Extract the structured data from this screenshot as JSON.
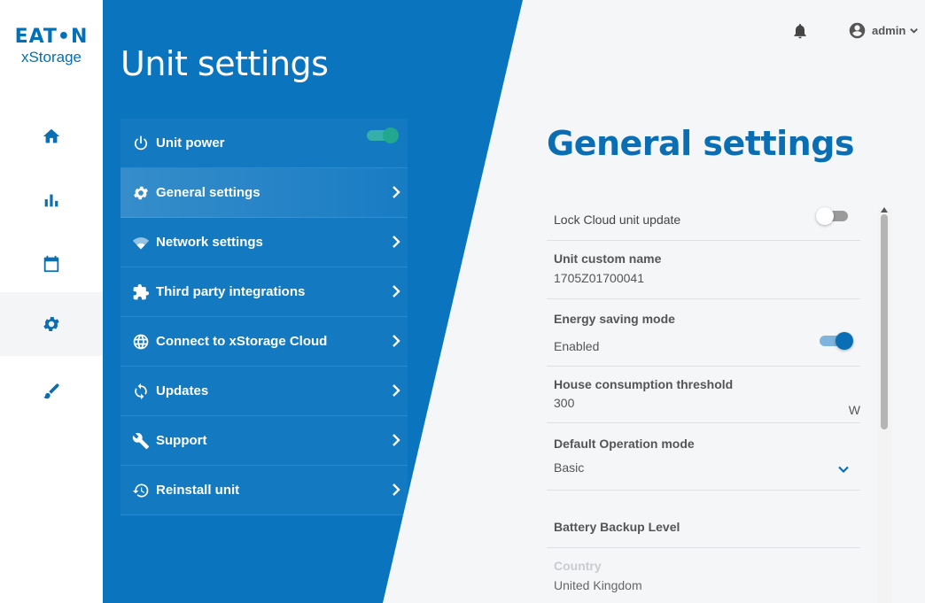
{
  "brand": {
    "logo_text": "EAT•N",
    "product": "xStorage"
  },
  "rail": {
    "items": [
      {
        "id": "home",
        "icon": "home-icon"
      },
      {
        "id": "stats",
        "icon": "bar-chart-icon"
      },
      {
        "id": "calendar",
        "icon": "calendar-icon"
      },
      {
        "id": "settings",
        "icon": "gear-icon",
        "active": true
      },
      {
        "id": "tools",
        "icon": "wrench-pencil-icon"
      }
    ]
  },
  "panel": {
    "title": "Unit settings",
    "items": [
      {
        "label": "Unit power",
        "icon": "power-icon",
        "toggle": true,
        "toggle_on": true
      },
      {
        "label": "General settings",
        "icon": "gear-icon",
        "active": true
      },
      {
        "label": "Network settings",
        "icon": "wifi-icon"
      },
      {
        "label": "Third party integrations",
        "icon": "puzzle-icon"
      },
      {
        "label": "Connect to xStorage Cloud",
        "icon": "globe-icon"
      },
      {
        "label": "Updates",
        "icon": "sync-icon"
      },
      {
        "label": "Support",
        "icon": "wrench-icon"
      },
      {
        "label": "Reinstall unit",
        "icon": "history-icon"
      }
    ]
  },
  "topbar": {
    "user_name": "admin"
  },
  "general": {
    "title": "General settings",
    "lock_cloud": {
      "label": "Lock Cloud unit update",
      "enabled": false
    },
    "custom_name": {
      "label": "Unit custom name",
      "value": "1705Z01700041"
    },
    "energy_saving": {
      "label": "Energy saving mode",
      "value": "Enabled",
      "enabled": true
    },
    "threshold": {
      "label": "House consumption threshold",
      "value": "300",
      "unit": "W"
    },
    "operation_mode": {
      "label": "Default Operation mode",
      "value": "Basic"
    },
    "battery_backup": {
      "label": "Battery Backup Level"
    },
    "country": {
      "label": "Country",
      "value": "United Kingdom"
    }
  },
  "colors": {
    "brand_blue": "#0a74bf",
    "toggle_green": "#22a88f",
    "text_grey": "#555555"
  }
}
